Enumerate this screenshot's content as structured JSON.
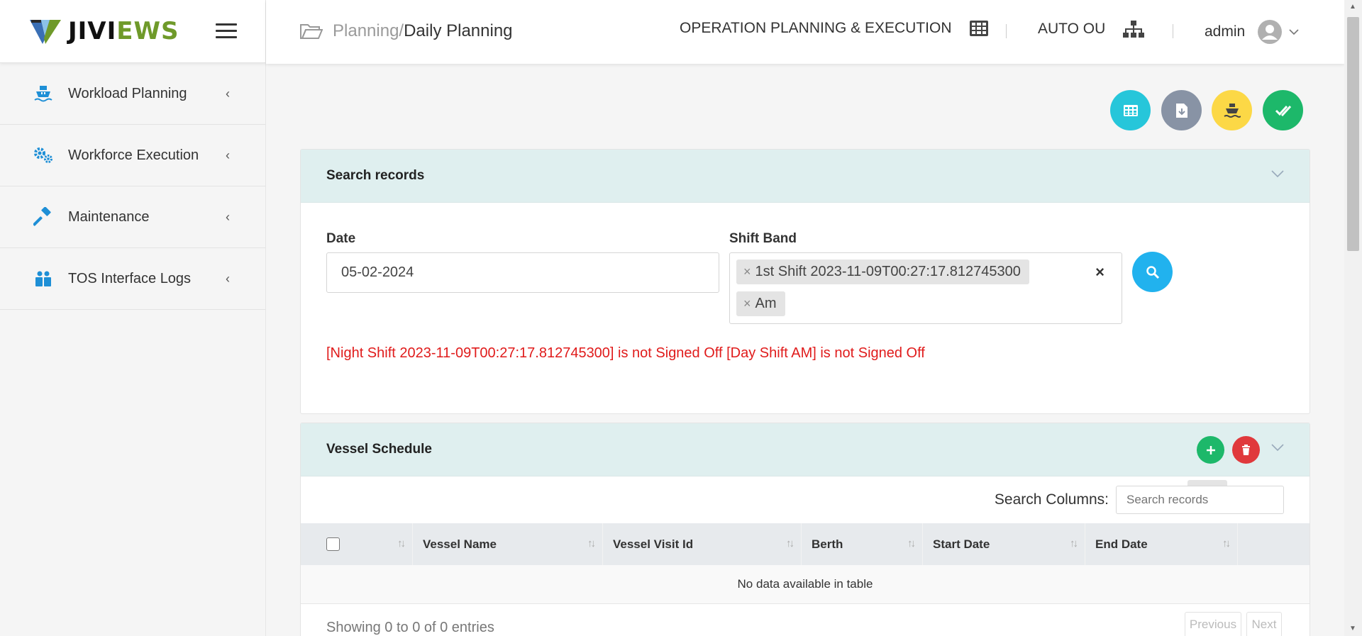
{
  "brand": {
    "part1": "JIVI",
    "part2": "EWS"
  },
  "sidebar": {
    "items": [
      {
        "label": "Workload Planning",
        "icon": "ship-icon"
      },
      {
        "label": "Workforce Execution",
        "icon": "gears-icon"
      },
      {
        "label": "Maintenance",
        "icon": "hammer-icon"
      },
      {
        "label": "TOS Interface Logs",
        "icon": "users-box-icon"
      }
    ]
  },
  "header": {
    "breadcrumb_parent": "Planning",
    "breadcrumb_sep": "/",
    "breadcrumb_current": "Daily Planning",
    "module": "OPERATION PLANNING & EXECUTION",
    "org_unit": "AUTO OU",
    "user": "admin"
  },
  "search_card": {
    "title": "Search records",
    "date_label": "Date",
    "date_value": "05-02-2024",
    "shift_label": "Shift Band",
    "shift_chips": [
      "1st Shift 2023-11-09T00:27:17.812745300",
      "Am"
    ],
    "error": "[Night Shift 2023-11-09T00:27:17.812745300] is not Signed Off [Day Shift AM] is not Signed Off"
  },
  "vessel_card": {
    "title": "Vessel Schedule",
    "tooltip": "Add",
    "search_label": "Search Columns:",
    "search_placeholder": "Search records",
    "columns": [
      "Vessel Name",
      "Vessel Visit Id",
      "Berth",
      "Start Date",
      "End Date"
    ],
    "empty_text": "No data available in table",
    "info": "Showing 0 to 0 of 0 entries",
    "prev": "Previous",
    "next": "Next"
  },
  "colors": {
    "accent_cyan": "#21b2ee",
    "btn_teal": "#26c6da",
    "btn_gray": "#8893a5",
    "btn_yellow": "#fcd846",
    "btn_green": "#1db86a",
    "btn_red": "#e0393c",
    "error_red": "#e01b1b",
    "header_bg": "#dfefef",
    "brand_green": "#6f9a2a"
  }
}
